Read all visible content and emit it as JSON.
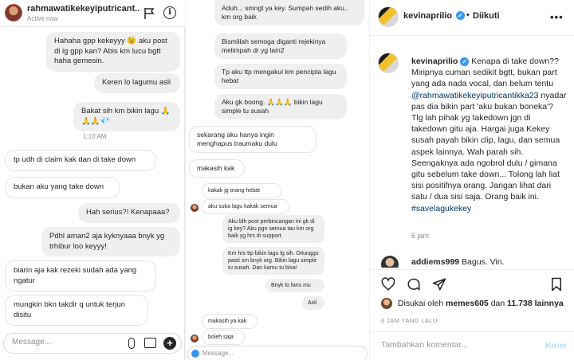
{
  "chat_left": {
    "header": {
      "name": "rahmawatikekeyiputricant...",
      "status": "Active now"
    },
    "messages": {
      "m1": "Hahaha gpp kekeyyy 😉 aku post di ig gpp kan? Abis km lucu bgtt haha gemesin.",
      "m2": "Keren lo lagumu asli",
      "m3": "Bakat sih km bikin lagu 🙏🙏🙏💎",
      "time": "1:10 AM",
      "m4": "tp udh di claim kak dan di take down",
      "m5": "bukan aku yang take down",
      "m6": "Hah serius?! Kenapaaa?",
      "m7": "Pdhl aman2 aja kyknyaaa bnyk yg trhibur loo keyyy!",
      "m8": "biarin aja kak rezeki sudah ada yang ngatur",
      "m9": "mungkin bkn takdir q untuk terjun disitu"
    },
    "composer_placeholder": "Message..."
  },
  "chat_right": {
    "messages": {
      "r1": "Aduh... smngt ya key. Sumpah sedih aku.. km org baik",
      "r2": "Bismillah semoga diganti rejekinya melimpah dr yg lain2",
      "r3": "Tp aku ttp mengakui km pencipta lagu hebat",
      "r4": "Aku gk boong. 🙏🙏🙏 bikin lagu simple tu susah",
      "r5": "sekarang aku hanya ingin menghapus traumaku dulu",
      "r6": "makasih kak",
      "r7": "kakak jg orang hebat",
      "r8": "aku suka lagu kakak semua",
      "r9": "Aku blh post perbincangan ini gk di ig key? Aku pgn semua tau km org baik yg hrs di support.",
      "r10": "Km hrs ttp bikin lagu lg sih. Ditunggu pasti sm bnyk org. Bikin lagu simple tu susah. Dan kamu tu bisa!",
      "r11": "Bnyk lo fans mu",
      "r12": "Asli",
      "r13": "makasih ya kak",
      "r14": "boleh saja"
    },
    "composer_placeholder": "Message..."
  },
  "post": {
    "username": "kevinaprilio",
    "separator": "•",
    "follow_status": "Diikuti",
    "more": "•••",
    "caption_user": "kevinaprilio",
    "caption_1": "Kenapa di take down?? Miripnya cuman sedikit bgtt, bukan part yang ada nada vocal, dan belum tentu",
    "caption_mention": "@rahmawatikekeyiputricantikka23",
    "caption_2": "nyadar pas dia bikin part 'aku bukan boneka'? Tlg lah pihak yg takedown jgn di takedown gitu aja. Hargai juga Kekey susah payah bikin clip, lagu, dan semua aspek lainnya. Wah parah sih. Seengaknya ada ngobrol dulu / gimana gitu sebelum take down... Tolong lah liat sisi positifnya orang. Jangan lihat dari satu / dua sisi saja. Orang baik ini.",
    "caption_hashtag": "#savelagukekey",
    "caption_age": "6 jam",
    "comment_user": "addiems999",
    "comment_text": "Bagus. Vin.",
    "likes_prefix": "Disukai oleh",
    "likes_user": "memes605",
    "likes_and": "dan",
    "likes_count": "11.738 lainnya",
    "post_time": "6 JAM YANG LALU",
    "add_comment_placeholder": "Tambahkan komentar...",
    "post_button": "Kirim"
  }
}
